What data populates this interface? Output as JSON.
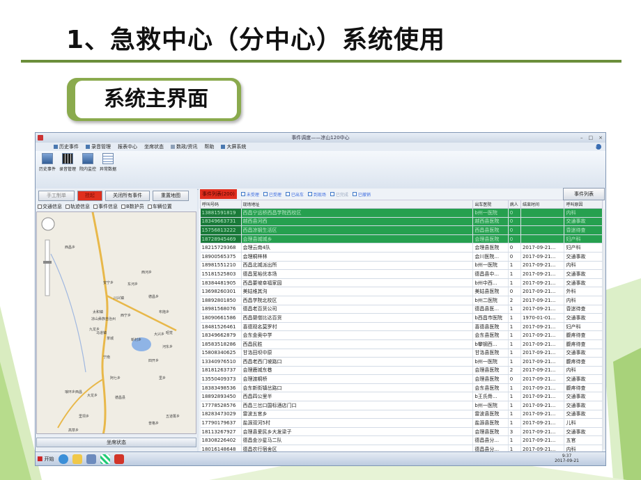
{
  "slide": {
    "title": "1、急救中心（分中心）系统使用",
    "badge": "系统主界面"
  },
  "app": {
    "window_title": "事件调度——凉山120中心",
    "menu": [
      "历史事件",
      "录音管理",
      "报表中心",
      "坐席状态",
      "数政/资讯",
      "帮助",
      "大屏系统"
    ],
    "ribbon_buttons": [
      {
        "label": "历史事件",
        "icon": "history-icon"
      },
      {
        "label": "录音管理",
        "icon": "film-icon"
      },
      {
        "label": "院内监控",
        "icon": "monitor-icon"
      },
      {
        "label": "异常数据",
        "icon": "grid-icon"
      }
    ],
    "left": {
      "buttons": [
        "手工制单",
        "挂起",
        "关闭所有事件",
        "重置地图"
      ],
      "checks": [
        "交通信息",
        "轨迹信息",
        "事件信息",
        "B数护员",
        "车辆位置"
      ],
      "map_labels": [
        "西昌乡",
        "凉山彝族自治州",
        "西河乡",
        "大兴乡",
        "茶城",
        "宁南",
        "西宁乡",
        "四开乡",
        "德昌乡",
        "昭觉",
        "布拖乡",
        "河东乡",
        "德昌县",
        "五道箐乡",
        "马道镇",
        "川兴镇",
        "太和镇",
        "安宁乡",
        "东河乡",
        "阿七乡",
        "里乡",
        "琅环乡",
        "大龙乡",
        "新村乡",
        "九龙乡",
        "西昌",
        "里坝乡",
        "高草乡",
        "普格乡"
      ],
      "status": "坐席状态"
    },
    "right": {
      "filter_tag": "事件列表(200)",
      "filters": [
        {
          "label": "未受理",
          "color": "#2e6ad8"
        },
        {
          "label": "已受理",
          "color": "#2e6ad8"
        },
        {
          "label": "已出车",
          "color": "#2e6ad8"
        },
        {
          "label": "到现场",
          "color": "#2e6ad8"
        },
        {
          "label": "已完成",
          "color": "#9aa8c0"
        },
        {
          "label": "已撤销",
          "color": "#2e6ad8"
        }
      ],
      "list_button": "事件列表",
      "columns": [
        "呼叫号码",
        "现场地址",
        "出车医院",
        "病人",
        "结束时间",
        "呼叫原因"
      ],
      "rows": [
        {
          "sel": true,
          "c": [
            "13881591819",
            "西昌宁远桥西昌学院西校区",
            "b州一医院",
            "0",
            "",
            "内科"
          ]
        },
        {
          "sel": true,
          "c": [
            "18349663731",
            "越西县河西",
            "越西县医院",
            "0",
            "",
            "交通事故"
          ]
        },
        {
          "sel": true,
          "c": [
            "15756813222",
            "西昌凉钢生活区",
            "西昌县医院",
            "0",
            "",
            "昏迷待查"
          ]
        },
        {
          "sel": true,
          "c": [
            "18728945469",
            "会理县城城乡",
            "会理县医院",
            "0",
            "",
            "妇产科"
          ]
        },
        {
          "sel": false,
          "c": [
            "18215729368",
            "会理云南4队",
            "会理县医院",
            "0",
            "2017-09-21...",
            "妇产科"
          ]
        },
        {
          "sel": false,
          "c": [
            "18900565375",
            "会理桐梓林",
            "会川医院...",
            "0",
            "2017-09-21...",
            "交通事故"
          ]
        },
        {
          "sel": false,
          "c": [
            "18981551210",
            "西昌北城派出所",
            "b州一医院",
            "1",
            "2017-09-21...",
            "内科"
          ]
        },
        {
          "sel": false,
          "c": [
            "15181525803",
            "德昌宽裕优本场",
            "德昌县中...",
            "1",
            "2017-09-21...",
            "交通事故"
          ]
        },
        {
          "sel": false,
          "c": [
            "18384481905",
            "西昌要坡幸福家园",
            "b州中西...",
            "1",
            "2017-09-21...",
            "交通事故"
          ]
        },
        {
          "sel": false,
          "c": [
            "13698260301",
            "美姑维其沟",
            "美姑县医院",
            "0",
            "2017-09-21...",
            "外科"
          ]
        },
        {
          "sel": false,
          "c": [
            "18892801850",
            "西昌学院北校区",
            "b州二医院",
            "2",
            "2017-09-21...",
            "内科"
          ]
        },
        {
          "sel": false,
          "c": [
            "18981568076",
            "德昌老百货公司",
            "德昌县医...",
            "1",
            "2017-09-21...",
            "昏迷待查"
          ]
        },
        {
          "sel": false,
          "c": [
            "18090661586",
            "西昌婴僧比达百货",
            "b西昌市医院",
            "1",
            "1970-01-01...",
            "交通事故"
          ]
        },
        {
          "sel": false,
          "c": [
            "18481526461",
            "喜德观名莫罗村",
            "喜德县医院",
            "1",
            "2017-09-21...",
            "妇产科"
          ]
        },
        {
          "sel": false,
          "c": [
            "18349662879",
            "会东金奥中学",
            "会东县医院",
            "1",
            "2017-09-21...",
            "腹疼待查"
          ]
        },
        {
          "sel": false,
          "c": [
            "18583518286",
            "西昌民胜",
            "b攀钢西...",
            "1",
            "2017-09-21...",
            "腹疼待查"
          ]
        },
        {
          "sel": false,
          "c": [
            "15808340625",
            "甘洛田坝中原",
            "甘洛县医院",
            "1",
            "2017-09-21...",
            "交通事故"
          ]
        },
        {
          "sel": false,
          "c": [
            "13340976510",
            "西昌老西门坡路口",
            "b州一医院",
            "1",
            "2017-09-21...",
            "腹疼待查"
          ]
        },
        {
          "sel": false,
          "c": [
            "18181263737",
            "会理鹿城东巷",
            "会理县医院",
            "2",
            "2017-09-21...",
            "内科"
          ]
        },
        {
          "sel": false,
          "c": [
            "13550409373",
            "会理渡桐桥",
            "会理县医院",
            "0",
            "2017-09-21...",
            "交通事故"
          ]
        },
        {
          "sel": false,
          "c": [
            "18383498536",
            "会东新街镇岔路口",
            "会东县医院",
            "1",
            "2017-09-21...",
            "腹疼待查"
          ]
        },
        {
          "sel": false,
          "c": [
            "18892893450",
            "西昌四公里半",
            "b王氏骨...",
            "1",
            "2017-09-21...",
            "交通事故"
          ]
        },
        {
          "sel": false,
          "c": [
            "17778528576",
            "西昌三岔口国标酒店门口",
            "b州一医院",
            "1",
            "2017-09-21...",
            "交通事故"
          ]
        },
        {
          "sel": false,
          "c": [
            "18283473029",
            "雷波五官乡",
            "雷波县医院",
            "1",
            "2017-09-21...",
            "交通事故"
          ]
        },
        {
          "sel": false,
          "c": [
            "17790179637",
            "盐源双河5村",
            "盐源县医院",
            "1",
            "2017-09-21...",
            "儿科"
          ]
        },
        {
          "sel": false,
          "c": [
            "18113267927",
            "会理县爱民乡大发梁子",
            "会理县医院",
            "3",
            "2017-09-21...",
            "交通事故"
          ]
        },
        {
          "sel": false,
          "c": [
            "18308226402",
            "德昌金沙星马二队",
            "德昌县分...",
            "1",
            "2017-09-21...",
            "五官"
          ]
        },
        {
          "sel": false,
          "c": [
            "18016148648",
            "德昌农行宿舍区",
            "德昌县分...",
            "1",
            "2017-09-21...",
            "内科"
          ]
        }
      ]
    },
    "taskbar": {
      "start": "开始",
      "time": "9:37",
      "date": "2017-09-21"
    }
  }
}
